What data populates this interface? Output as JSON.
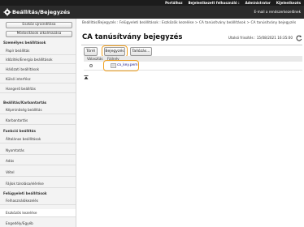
{
  "top_nav": {
    "links": [
      "Portálhoz",
      "Bejelentkezett felhasználó :",
      "Administrator",
      "Kijelentkezés"
    ]
  },
  "header": {
    "title": "Beállítás/Bejegyzés",
    "mail_link": "E-mail a rendszerkezelőnek"
  },
  "sidebar": {
    "buttons": [
      "Eszköz újraindítása",
      "Módosítások alkalmazása"
    ],
    "items": [
      {
        "type": "section",
        "label": "Személyes beállítások"
      },
      {
        "type": "item",
        "label": "Papír beállítás"
      },
      {
        "type": "item",
        "label": "Időzítés/Energia beállítások"
      },
      {
        "type": "item",
        "label": "Hálózati beállítások"
      },
      {
        "type": "item",
        "label": "Külső interfész"
      },
      {
        "type": "item",
        "label": "Hangerő beállítás"
      },
      {
        "type": "section",
        "label": "Beállítás/Karbantartás"
      },
      {
        "type": "item",
        "label": "Képminőség beállítás"
      },
      {
        "type": "item",
        "label": "Karbantartás"
      },
      {
        "type": "section",
        "label": "Funkció beállítás"
      },
      {
        "type": "item",
        "label": "Általános beállítások"
      },
      {
        "type": "item",
        "label": "Nyomtatás"
      },
      {
        "type": "item",
        "label": "Adás"
      },
      {
        "type": "item",
        "label": "Vétel"
      },
      {
        "type": "item",
        "label": "Fájlok tárolása/elérése"
      },
      {
        "type": "section",
        "label": "Felügyeleti beállítások"
      },
      {
        "type": "item",
        "label": "Felhasználókezelés"
      },
      {
        "type": "item",
        "label": "Eszközök kezelése"
      },
      {
        "type": "item",
        "label": "Engedély/Egyéb"
      }
    ]
  },
  "main": {
    "breadcrumb": "Beállítás/Bejegyzés : Felügyeleti beállítások : Eszközök kezelése > CA tanúsítvány beállítások > CA tanúsítvány bejegyzés",
    "title": "CA tanúsítvány bejegyzés",
    "last_updated": "Utolsó frissítés : 15/08/2021 16:35:00",
    "buttons": {
      "back": "Törél",
      "register": "Bejegyzés",
      "browse": "Tallózás..."
    },
    "table": {
      "headers": [
        "Választás",
        "Fájlnév"
      ],
      "rows": [
        {
          "filename": "ca_key.pem"
        }
      ]
    }
  },
  "colors": {
    "header_bg": "#2b2b2b",
    "top_bar_bg": "#1c1c1c",
    "highlight": "#f0a020",
    "sidebar_bg": "#f3f3f3"
  },
  "icons": {
    "title": "gear-icon",
    "refresh": "refresh-icon",
    "file": "file-icon",
    "back_to_top": "back-to-top-icon"
  }
}
